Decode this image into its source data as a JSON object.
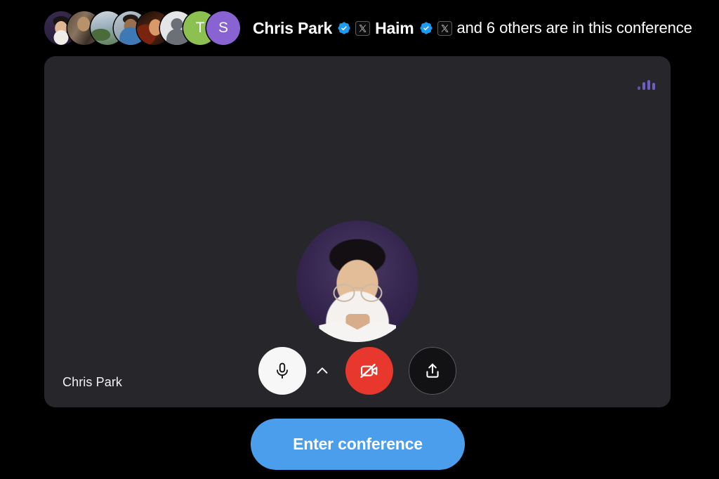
{
  "header": {
    "participants_avatars": [
      {
        "name": "Chris Park",
        "kind": "photo",
        "style": "ph-chris",
        "initial": ""
      },
      {
        "name": "participant-2",
        "kind": "photo",
        "style": "ph-bike",
        "initial": ""
      },
      {
        "name": "participant-3",
        "kind": "photo",
        "style": "ph-outdoor",
        "initial": ""
      },
      {
        "name": "participant-4",
        "kind": "photo",
        "style": "ph-beard",
        "initial": ""
      },
      {
        "name": "participant-5",
        "kind": "photo",
        "style": "ph-warm",
        "initial": ""
      },
      {
        "name": "participant-6",
        "kind": "silhouette",
        "style": "ph-silhouette",
        "initial": ""
      },
      {
        "name": "participant-7",
        "kind": "initial",
        "style": "",
        "initial": "T",
        "color": "#8cc152"
      },
      {
        "name": "participant-8",
        "kind": "initial",
        "style": "",
        "initial": "S",
        "color": "#8a63d2"
      }
    ],
    "name_first": "Chris Park",
    "name_second": "Haim",
    "trailing_text": "and 6 others are in this conference",
    "verified_badge_color": "#1d9bf0",
    "x_chip_label": "X"
  },
  "video_panel": {
    "self_name": "Chris Park",
    "audio_meter_color": "#6d5fc4",
    "avatar_background": "#33244c",
    "panel_background": "#27272b"
  },
  "controls": {
    "mic_button": {
      "label": "Microphone",
      "icon": "microphone-icon",
      "state": "on",
      "bg": "#f7f7f7"
    },
    "mic_options_button": {
      "label": "Audio options",
      "icon": "chevron-up-icon"
    },
    "video_button": {
      "label": "Camera off",
      "icon": "video-off-icon",
      "state": "off",
      "bg": "#e8372c"
    },
    "share_button": {
      "label": "Share screen",
      "icon": "share-upload-icon",
      "bg": "#121214"
    }
  },
  "primary_action": {
    "label": "Enter conference",
    "color": "#4a9eeb"
  }
}
